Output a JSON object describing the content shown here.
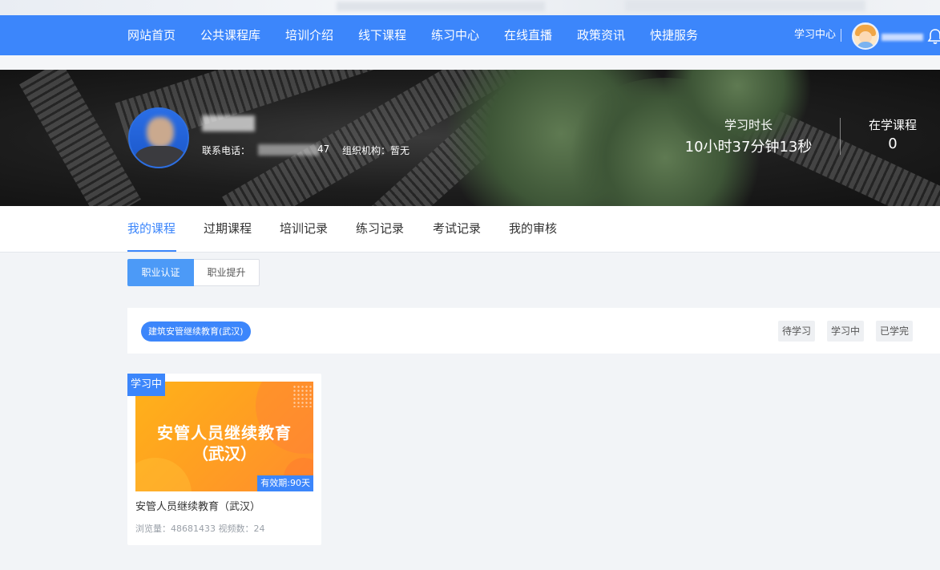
{
  "nav": {
    "items": [
      "网站首页",
      "公共课程库",
      "培训介绍",
      "线下课程",
      "练习中心",
      "在线直播",
      "政策资讯",
      "快捷服务"
    ],
    "learning_center": "学习中心"
  },
  "profile": {
    "phone_label": "联系电话：",
    "phone_tail": "47",
    "org": "组织机构：暂无",
    "stats": {
      "study_time_label": "学习时长",
      "study_time_value": "10小时37分钟13秒",
      "courses_label": "在学课程",
      "courses_value": "0"
    }
  },
  "tabs": [
    "我的课程",
    "过期课程",
    "培训记录",
    "练习记录",
    "考试记录",
    "我的审核"
  ],
  "segments": {
    "on": "职业认证",
    "off": "职业提升"
  },
  "filter": {
    "chip": "建筑安管继续教育(武汉)",
    "statuses": [
      "待学习",
      "学习中",
      "已学完"
    ]
  },
  "course": {
    "badge": "学习中",
    "thumb_line1": "安管人员继续教育",
    "thumb_line2": "（武汉）",
    "validity": "有效期:90天",
    "title": "安管人员继续教育（武汉）",
    "meta": "浏览量：48681433  视频数：24"
  },
  "colors": {
    "brand": "#3c86fb",
    "page_bg": "#f2f4f7"
  }
}
